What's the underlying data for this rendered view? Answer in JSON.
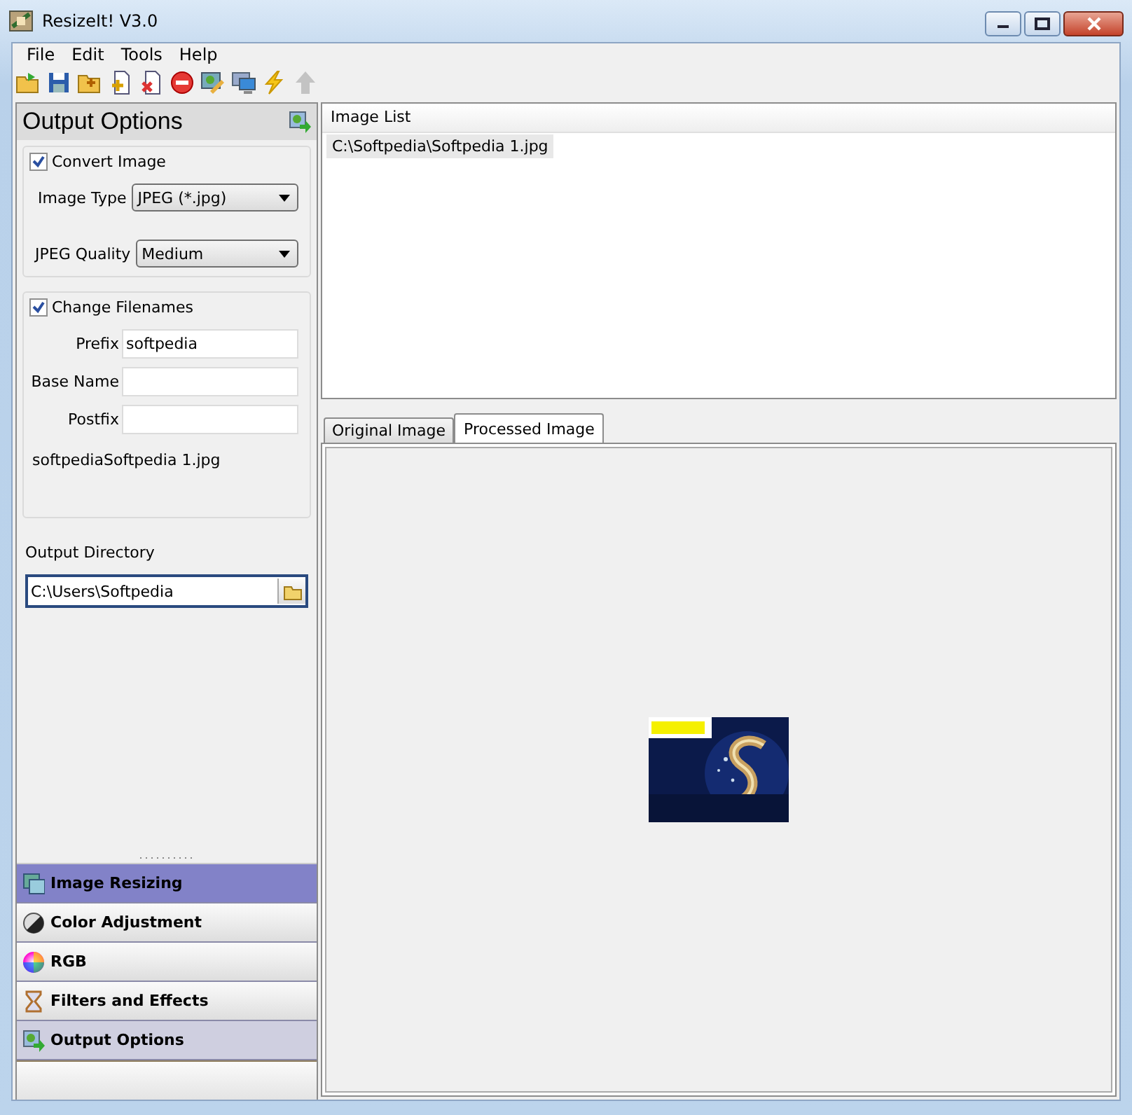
{
  "window": {
    "title": "ResizeIt! V3.0"
  },
  "menu": [
    {
      "label": "File"
    },
    {
      "label": "Edit"
    },
    {
      "label": "Tools"
    },
    {
      "label": "Help"
    }
  ],
  "toolbar": [
    {
      "kind": "open",
      "disabled": false
    },
    {
      "kind": "save",
      "disabled": false
    },
    {
      "kind": "add-folder",
      "disabled": false
    },
    {
      "kind": "add-file",
      "disabled": false
    },
    {
      "kind": "remove-file",
      "disabled": false
    },
    {
      "kind": "stop",
      "disabled": false
    },
    {
      "kind": "edit",
      "disabled": false
    },
    {
      "kind": "monitor",
      "disabled": false
    },
    {
      "kind": "lightning",
      "disabled": false
    },
    {
      "kind": "up",
      "disabled": true
    }
  ],
  "output_panel": {
    "title": "Output Options",
    "convert": {
      "label": "Convert Image",
      "checked": true,
      "fields": [
        {
          "label": "Image Type",
          "value": "JPEG (*.jpg)"
        },
        {
          "label": "JPEG Quality",
          "value": "Medium"
        }
      ]
    },
    "filenames": {
      "label": "Change Filenames",
      "checked": true,
      "fields": [
        {
          "label": "Prefix",
          "value": "softpedia"
        },
        {
          "label": "Base Name"
        },
        {
          "label": "Postfix"
        }
      ],
      "preview": "softpediaSoftpedia 1.jpg"
    },
    "output_directory": {
      "label": "Output Directory",
      "value": "C:\\Users\\Softpedia"
    }
  },
  "nav": [
    {
      "label": "Image Resizing",
      "kind": "resize",
      "selected": true,
      "active": false
    },
    {
      "label": "Color Adjustment",
      "kind": "color",
      "selected": false,
      "active": false
    },
    {
      "label": "RGB",
      "kind": "rgb",
      "selected": false,
      "active": false
    },
    {
      "label": "Filters and Effects",
      "kind": "filters",
      "selected": false,
      "active": false
    },
    {
      "label": "Output Options",
      "kind": "output",
      "selected": false,
      "active": true
    }
  ],
  "image_list": {
    "header": "Image List",
    "items": [
      {
        "label": "C:\\Softpedia\\Softpedia 1.jpg",
        "selected": true
      }
    ]
  },
  "preview_tabs": [
    {
      "label": "Original Image",
      "selected": false
    },
    {
      "label": "Processed Image",
      "selected": true
    }
  ]
}
